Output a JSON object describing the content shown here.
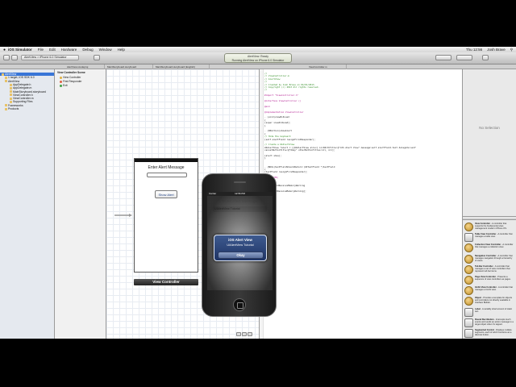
{
  "menubar": {
    "items": [
      "iOS Simulator",
      "File",
      "Edit",
      "Hardware",
      "Debug",
      "Window",
      "Help"
    ],
    "clock": "Thu 12:56",
    "user": "Josh Brave"
  },
  "toolbar": {
    "scheme": "AlertView > iPhone 6.0 Simulator",
    "activity_line1": "AlertView: Ready",
    "activity_line2": "Running AlertView on iPhone 6.0 Simulator"
  },
  "tabs": [
    "AlertView.xcodeproj",
    "MainStoryboard.storyboard",
    "MainStoryboard.storyboard (English)",
    "ViewController.m"
  ],
  "navigator": {
    "items": [
      {
        "label": "AlertView",
        "sel": true
      },
      {
        "label": "1 target, iOS SDK 6.0",
        "sel": false
      },
      {
        "label": "AlertView",
        "sel": false
      },
      {
        "label": "AppDelegate.h",
        "sel": false
      },
      {
        "label": "AppDelegate.m",
        "sel": false
      },
      {
        "label": "MainStoryboard.storyboard",
        "sel": false
      },
      {
        "label": "ViewController.h",
        "sel": false
      },
      {
        "label": "ViewController.m",
        "sel": false
      },
      {
        "label": "Supporting Files",
        "sel": false
      },
      {
        "label": "Frameworks",
        "sel": false
      },
      {
        "label": "Products",
        "sel": false
      }
    ]
  },
  "outline": {
    "items": [
      "View Controller Scene",
      "View Controller",
      "First Responder",
      "Exit"
    ]
  },
  "storyboard": {
    "view_title": "Enter Alert Message",
    "button_label": "Show Alert",
    "footer": "View Controller"
  },
  "editor": {
    "lines": [
      {
        "cls": "c-comment",
        "text": "//"
      },
      {
        "cls": "c-comment",
        "text": "//  ViewController.m"
      },
      {
        "cls": "c-comment",
        "text": "//  AlertView"
      },
      {
        "cls": "c-comment",
        "text": "//"
      },
      {
        "cls": "c-comment",
        "text": "//  Created by Josh Brave on 04/01/2013."
      },
      {
        "cls": "c-comment",
        "text": "//  Copyright (c) 2013 All rights reserved."
      },
      {
        "cls": "c-comment",
        "text": "//"
      },
      {
        "cls": "c-plain",
        "text": ""
      },
      {
        "cls": "c-key",
        "text": "#import \"ViewController.h\""
      },
      {
        "cls": "c-plain",
        "text": ""
      },
      {
        "cls": "c-key",
        "text": "@interface ViewController ()"
      },
      {
        "cls": "c-plain",
        "text": ""
      },
      {
        "cls": "c-key",
        "text": "@end"
      },
      {
        "cls": "c-plain",
        "text": ""
      },
      {
        "cls": "c-key",
        "text": "@implementation ViewController"
      },
      {
        "cls": "c-plain",
        "text": ""
      },
      {
        "cls": "c-plain",
        "text": "- (void)viewDidLoad"
      },
      {
        "cls": "c-plain",
        "text": "{"
      },
      {
        "cls": "c-plain",
        "text": "    [super viewDidLoad];"
      },
      {
        "cls": "c-plain",
        "text": "}"
      },
      {
        "cls": "c-plain",
        "text": ""
      },
      {
        "cls": "c-plain",
        "text": "- (IBAction)showAlert"
      },
      {
        "cls": "c-plain",
        "text": "{"
      },
      {
        "cls": "c-comment",
        "text": "    // Hide the keyboard"
      },
      {
        "cls": "c-plain",
        "text": "    [self.alertField resignFirstResponder];"
      },
      {
        "cls": "c-plain",
        "text": ""
      },
      {
        "cls": "c-comment",
        "text": "    // Create a UIAlertView"
      },
      {
        "cls": "c-plain",
        "text": "    UIAlertView *alert = [[UIAlertView alloc] initWithTitle:@\"iOS Alert View\" message:self.alertField.text delegate:self"
      },
      {
        "cls": "c-plain",
        "text": "        cancelButtonTitle:@\"Okay\" otherButtonTitles:nil, nil];"
      },
      {
        "cls": "c-plain",
        "text": ""
      },
      {
        "cls": "c-plain",
        "text": "    [alert show];"
      },
      {
        "cls": "c-plain",
        "text": "}"
      },
      {
        "cls": "c-plain",
        "text": ""
      },
      {
        "cls": "c-plain",
        "text": ""
      },
      {
        "cls": "c-plain",
        "text": "- (BOOL)textFieldShouldReturn:(UITextField *)textField"
      },
      {
        "cls": "c-plain",
        "text": "{"
      },
      {
        "cls": "c-plain",
        "text": "    [textField resignFirstResponder];"
      },
      {
        "cls": "c-plain",
        "text": ""
      },
      {
        "cls": "c-key",
        "text": "    return YES;"
      },
      {
        "cls": "c-plain",
        "text": "}"
      },
      {
        "cls": "c-plain",
        "text": ""
      },
      {
        "cls": "c-plain",
        "text": "- (void)didReceiveMemoryWarning"
      },
      {
        "cls": "c-plain",
        "text": "{"
      },
      {
        "cls": "c-plain",
        "text": "    [super didReceiveMemoryWarning];"
      },
      {
        "cls": "c-plain",
        "text": "}"
      },
      {
        "cls": "c-plain",
        "text": ""
      },
      {
        "cls": "c-key",
        "text": "@end"
      }
    ]
  },
  "utilities": {
    "no_selection": "No Selection",
    "library": [
      {
        "icon": "round",
        "title": "View Controller",
        "desc": "- A controller that supports the fundamental view-management model in iPhone OS."
      },
      {
        "icon": "sq",
        "title": "Table View Controller",
        "desc": "- A controller that manages a table view."
      },
      {
        "icon": "round",
        "title": "Collection View Controller",
        "desc": "- A controller that manages a collection view."
      },
      {
        "icon": "round",
        "title": "Navigation Controller",
        "desc": "- A controller that manages navigation through a hierarchy of views."
      },
      {
        "icon": "round",
        "title": "Tab Bar Controller",
        "desc": "- A controller that manages a set of view controllers that represent tab bar items."
      },
      {
        "icon": "round",
        "title": "Page View Controller",
        "desc": "- Presents a sequence of view controllers as pages."
      },
      {
        "icon": "round",
        "title": "GLKit View Controller",
        "desc": "- A controller that manages a GLKit view."
      },
      {
        "icon": "round",
        "title": "Object",
        "desc": "- Provides a template for objects and controllers not directly available in Interface Builder."
      },
      {
        "icon": "sq",
        "title": "Label",
        "desc": "- A variably sized amount of static text."
      },
      {
        "icon": "sq",
        "title": "Round Rect Button",
        "desc": "- Intercepts touch events and sends an action message to a target object when it's tapped."
      },
      {
        "icon": "sq",
        "title": "Segmented Control",
        "desc": "- Displays multiple segments, each of which functions as a discrete button."
      }
    ]
  },
  "simulator": {
    "carrier": "Carrier",
    "time": "12:56 PM",
    "title": "Enter Alert Message",
    "field_value": "UIAlertView Tutorial",
    "alert_title": "iOS Alert View",
    "alert_message": "UIAlertView Tutorial",
    "alert_button": "Okay"
  },
  "dock": {
    "icons": [
      "finder",
      "launchpad",
      "mission-control",
      "safari",
      "mail",
      "contacts",
      "calendar",
      "notes",
      "reminders",
      "maps",
      "messages",
      "facetime",
      "photo-booth",
      "iphoto",
      "itunes",
      "app-store",
      "system-preferences",
      "xcode",
      "ios-simulator",
      "terminal",
      "activity-monitor",
      "preview",
      "downloads",
      "trash"
    ],
    "colors": [
      "#4a90d9",
      "#9aa7b5",
      "#6d5fa8",
      "#3a8de0",
      "#8fb7e5",
      "#b08a5c",
      "#f2f2f2",
      "#f4e27a",
      "#ffffff",
      "#6fb86f",
      "#5ab0ec",
      "#3f9f3f",
      "#c0392b",
      "#5f9ed8",
      "#7ab5e6",
      "#3d8fe0",
      "#8a8a8a",
      "#4f86c9",
      "#bcc7d6",
      "#222222",
      "#3a3a3a",
      "#c7d8ea",
      "#5c8cc2",
      "#c9ccd2"
    ]
  }
}
